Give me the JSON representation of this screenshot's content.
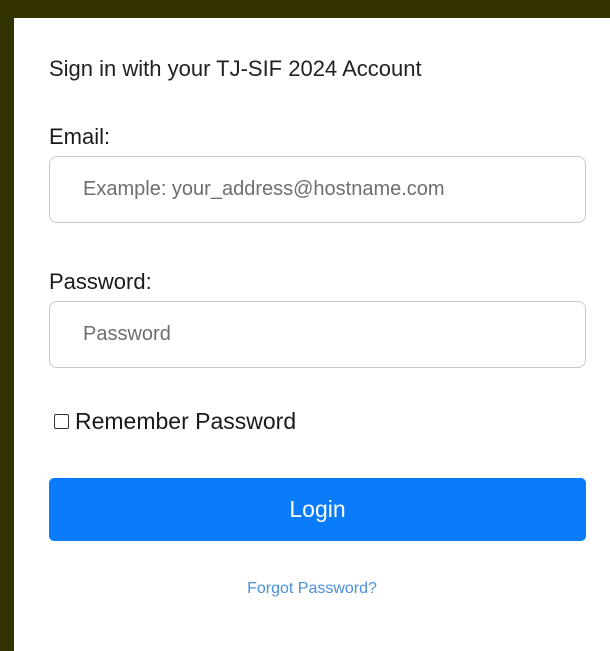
{
  "login_form": {
    "heading": "Sign in with your TJ-SIF 2024 Account",
    "email_label": "Email:",
    "email_placeholder": "Example: your_address@hostname.com",
    "email_value": "",
    "password_label": "Password:",
    "password_placeholder": "Password",
    "password_value": "",
    "remember_label": "Remember Password",
    "remember_checked": false,
    "login_label": "Login",
    "forgot_label": "Forgot Password?"
  },
  "colors": {
    "page_background": "#333300",
    "primary_button": "#0a7cfa",
    "link": "#4a8fd9"
  }
}
